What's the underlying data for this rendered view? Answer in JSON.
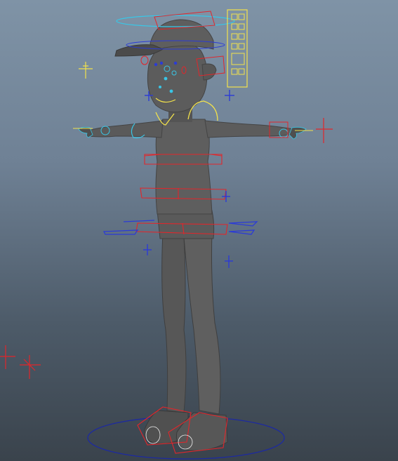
{
  "viewport": {
    "title": "",
    "background_top": "#7f93a6",
    "background_bottom": "#3a434c"
  },
  "character": {
    "body_color": "#5b5b5b",
    "shade_color": "#3f3f3f",
    "highlight_color": "#6e6e6e"
  },
  "rig": {
    "control_red": "#e1262b",
    "control_yellow": "#f2e24b",
    "control_cyan": "#39c6e6",
    "control_blue": "#2b3bd6",
    "control_dark_blue": "#1d2aa0"
  },
  "icons": {
    "locator": "locator-cross-icon",
    "facial_panel": "facial-control-panel-icon"
  }
}
